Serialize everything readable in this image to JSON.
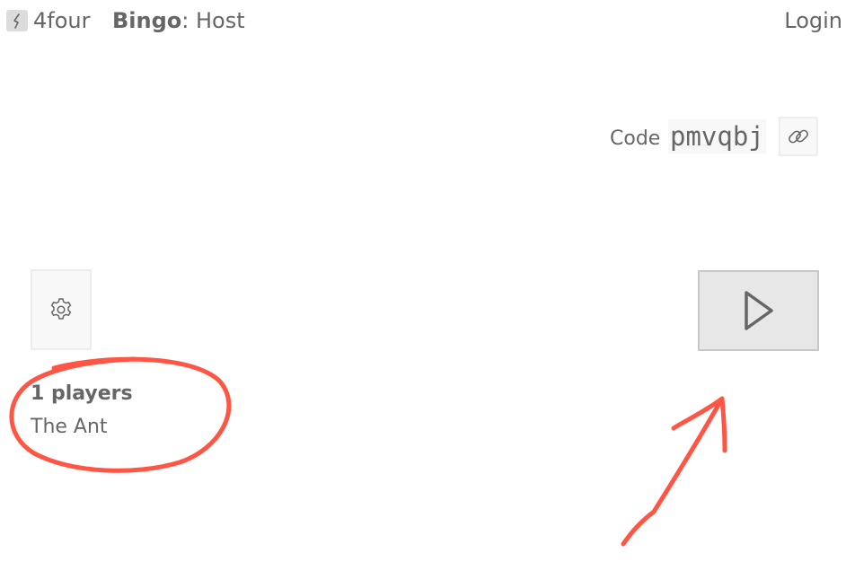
{
  "header": {
    "brand": "4four",
    "game_name": "Bingo",
    "separator": ":",
    "role": " Host",
    "login_label": "Login"
  },
  "session": {
    "code_label": "Code",
    "code_value": "pmvqbj",
    "link_icon": "link-icon"
  },
  "controls": {
    "settings_icon": "gear-icon",
    "start_icon": "play-icon"
  },
  "players": {
    "count_label": "1 players",
    "list": [
      "The Ant"
    ]
  },
  "annotation": {
    "color": "#ff5544"
  }
}
